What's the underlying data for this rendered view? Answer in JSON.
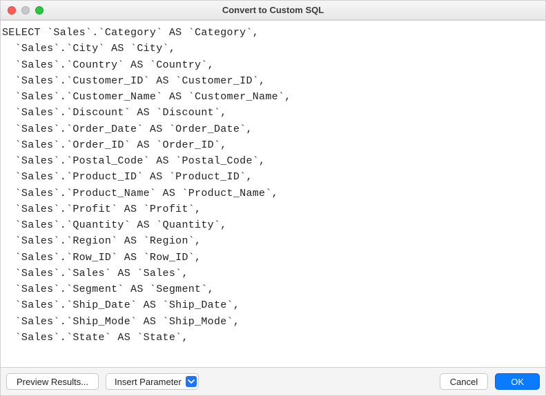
{
  "window": {
    "title": "Convert to Custom SQL"
  },
  "sql": {
    "first_line_keyword": "SELECT",
    "indent": "  ",
    "table": "Sales",
    "columns": [
      "Category",
      "City",
      "Country",
      "Customer_ID",
      "Customer_Name",
      "Discount",
      "Order_Date",
      "Order_ID",
      "Postal_Code",
      "Product_ID",
      "Product_Name",
      "Profit",
      "Quantity",
      "Region",
      "Row_ID",
      "Sales",
      "Segment",
      "Ship_Date",
      "Ship_Mode",
      "State"
    ]
  },
  "footer": {
    "preview_label": "Preview Results...",
    "insert_param_label": "Insert Parameter",
    "cancel_label": "Cancel",
    "ok_label": "OK"
  },
  "icons": {
    "close": "close-icon",
    "minimize": "minimize-icon",
    "maximize": "maximize-icon",
    "chevron_down": "chevron-down-icon"
  }
}
